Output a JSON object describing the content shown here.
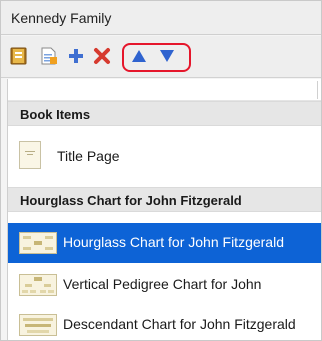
{
  "window": {
    "title": "Kennedy Family"
  },
  "toolbar": {
    "buttons": [
      {
        "icon": "book-icon"
      },
      {
        "icon": "add-page-icon"
      },
      {
        "icon": "plus-icon"
      },
      {
        "icon": "delete-x-icon"
      },
      {
        "icon": "move-up-triangle-icon"
      },
      {
        "icon": "move-down-triangle-icon"
      }
    ],
    "highlight_color": "#e5162b"
  },
  "sections": [
    {
      "header": "Book Items",
      "items": [
        {
          "label": "Title Page",
          "icon": "title-page-thumbnail-icon"
        }
      ]
    },
    {
      "header": "Hourglass Chart for John Fitzgerald",
      "items": [
        {
          "label": "Hourglass Chart for John Fitzgerald",
          "icon": "hourglass-chart-thumbnail-icon",
          "selected": true
        },
        {
          "label": "Vertical Pedigree Chart for John",
          "icon": "pedigree-chart-thumbnail-icon"
        },
        {
          "label": "Descendant Chart for John Fitzgerald",
          "icon": "descendant-chart-thumbnail-icon"
        }
      ]
    }
  ],
  "colors": {
    "selection": "#0d63d6",
    "section_header": "#e6e6e6",
    "toolbar_accent_blue": "#3f6fd1",
    "delete_red": "#d63a2f"
  }
}
